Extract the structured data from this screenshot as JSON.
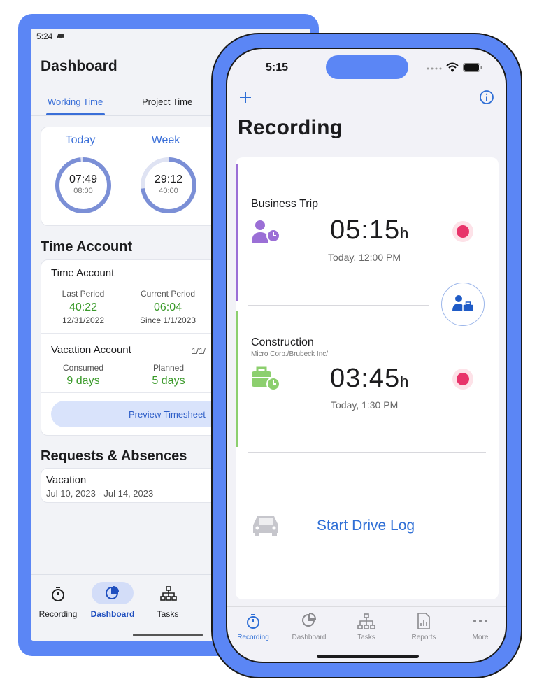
{
  "android": {
    "status_time": "5:24",
    "title": "Dashboard",
    "tabs": [
      {
        "label": "Working Time",
        "active": true
      },
      {
        "label": "Project Time",
        "active": false
      }
    ],
    "rings": [
      {
        "label": "Today",
        "value": "07:49",
        "target": "08:00"
      },
      {
        "label": "Week",
        "value": "29:12",
        "target": "40:00"
      }
    ],
    "time_account_section": "Time Account",
    "time_account": {
      "title": "Time Account",
      "last_period_label": "Last Period",
      "last_period_value": "40:22",
      "last_period_date": "12/31/2022",
      "current_period_label": "Current Period",
      "current_period_value": "06:04",
      "current_period_date": "Since 1/1/2023"
    },
    "vacation_account": {
      "title": "Vacation Account",
      "date_fragment": "1/1/",
      "consumed_label": "Consumed",
      "consumed_value": "9 days",
      "planned_label": "Planned",
      "planned_value": "5 days"
    },
    "preview_button": "Preview Timesheet",
    "requests_section": "Requests & Absences",
    "request": {
      "title": "Vacation",
      "dates": "Jul 10, 2023 - Jul 14, 2023"
    },
    "nav": [
      {
        "label": "Recording",
        "icon": "stopwatch-icon",
        "active": false
      },
      {
        "label": "Dashboard",
        "icon": "pie-chart-icon",
        "active": true
      },
      {
        "label": "Tasks",
        "icon": "hierarchy-icon",
        "active": false
      }
    ],
    "colors": {
      "accent": "#3a6fd8",
      "green": "#3a9a2a",
      "device": "#5b86f5"
    }
  },
  "iphone": {
    "status_time": "5:15",
    "add_icon": "plus-icon",
    "info_icon": "info-icon",
    "title": "Recording",
    "entries": [
      {
        "title": "Business Trip",
        "subtitle": "",
        "time": "05:15",
        "unit": "h",
        "date": "Today, 12:00 PM",
        "icon": "person-clock-icon",
        "color": "#9b6fd6"
      },
      {
        "title": "Construction",
        "subtitle": "Micro Corp./Brubeck Inc/",
        "time": "03:45",
        "unit": "h",
        "date": "Today, 1:30 PM",
        "icon": "briefcase-clock-icon",
        "color": "#8ccf6e"
      }
    ],
    "switch_icon": "person-briefcase-icon",
    "drive_log": {
      "label": "Start Drive Log",
      "icon": "car-icon"
    },
    "nav": [
      {
        "label": "Recording",
        "icon": "stopwatch-icon",
        "active": true
      },
      {
        "label": "Dashboard",
        "icon": "pie-chart-icon",
        "active": false
      },
      {
        "label": "Tasks",
        "icon": "hierarchy-icon",
        "active": false
      },
      {
        "label": "Reports",
        "icon": "report-icon",
        "active": false
      },
      {
        "label": "More",
        "icon": "more-icon",
        "active": false
      }
    ],
    "colors": {
      "accent": "#2f6fd6",
      "record": "#e8346a"
    }
  }
}
